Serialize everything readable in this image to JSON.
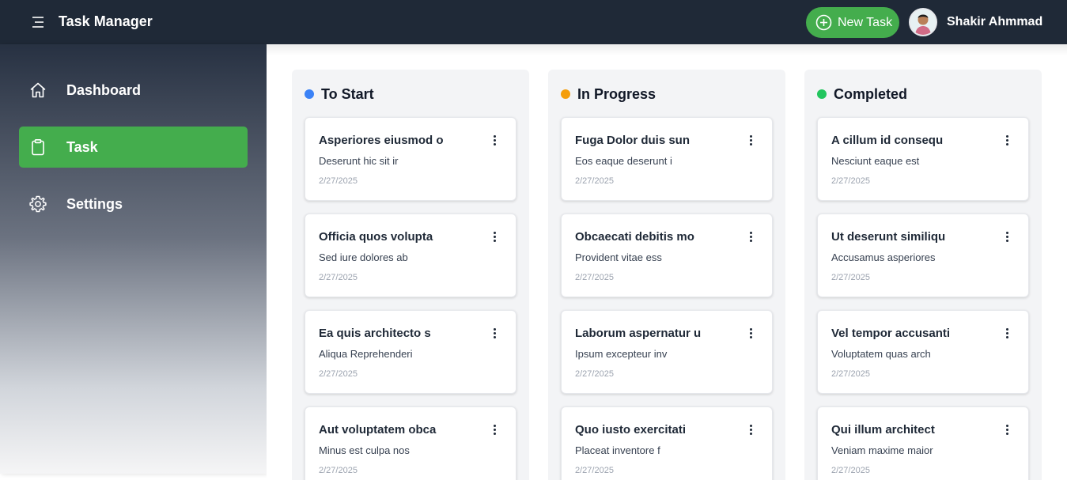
{
  "header": {
    "title": "Task Manager",
    "new_task_label": "New Task",
    "user_name": "Shakir Ahmmad"
  },
  "sidebar": {
    "items": [
      {
        "label": "Dashboard",
        "icon": "home-icon"
      },
      {
        "label": "Task",
        "icon": "clipboard-icon",
        "active": true
      },
      {
        "label": "Settings",
        "icon": "gear-icon"
      }
    ]
  },
  "colors": {
    "accent": "#44ad4d",
    "topbar": "#1f2937",
    "to_start": "#3b82f6",
    "in_progress": "#f59e0b",
    "completed": "#22c55e"
  },
  "board": {
    "columns": [
      {
        "title": "To Start",
        "tasks": [
          {
            "title": "Asperiores eiusmod o",
            "desc": "Deserunt hic sit ir",
            "date": "2/27/2025"
          },
          {
            "title": "Officia quos volupta",
            "desc": "Sed iure dolores ab",
            "date": "2/27/2025"
          },
          {
            "title": "Ea quis architecto s",
            "desc": "Aliqua Reprehenderi",
            "date": "2/27/2025"
          },
          {
            "title": "Aut voluptatem obca",
            "desc": "Minus est culpa nos",
            "date": "2/27/2025"
          }
        ]
      },
      {
        "title": "In Progress",
        "tasks": [
          {
            "title": "Fuga Dolor duis sun",
            "desc": "Eos eaque deserunt i",
            "date": "2/27/2025"
          },
          {
            "title": "Obcaecati debitis mo",
            "desc": "Provident vitae ess",
            "date": "2/27/2025"
          },
          {
            "title": "Laborum aspernatur u",
            "desc": "Ipsum excepteur inv",
            "date": "2/27/2025"
          },
          {
            "title": "Quo iusto exercitati",
            "desc": "Placeat inventore f",
            "date": "2/27/2025"
          }
        ]
      },
      {
        "title": "Completed",
        "tasks": [
          {
            "title": "A cillum id consequ",
            "desc": "Nesciunt eaque est",
            "date": "2/27/2025"
          },
          {
            "title": "Ut deserunt similiqu",
            "desc": "Accusamus asperiores",
            "date": "2/27/2025"
          },
          {
            "title": "Vel tempor accusanti",
            "desc": "Voluptatem quas arch",
            "date": "2/27/2025"
          },
          {
            "title": "Qui illum architect",
            "desc": "Veniam maxime maior",
            "date": "2/27/2025"
          }
        ]
      }
    ]
  }
}
